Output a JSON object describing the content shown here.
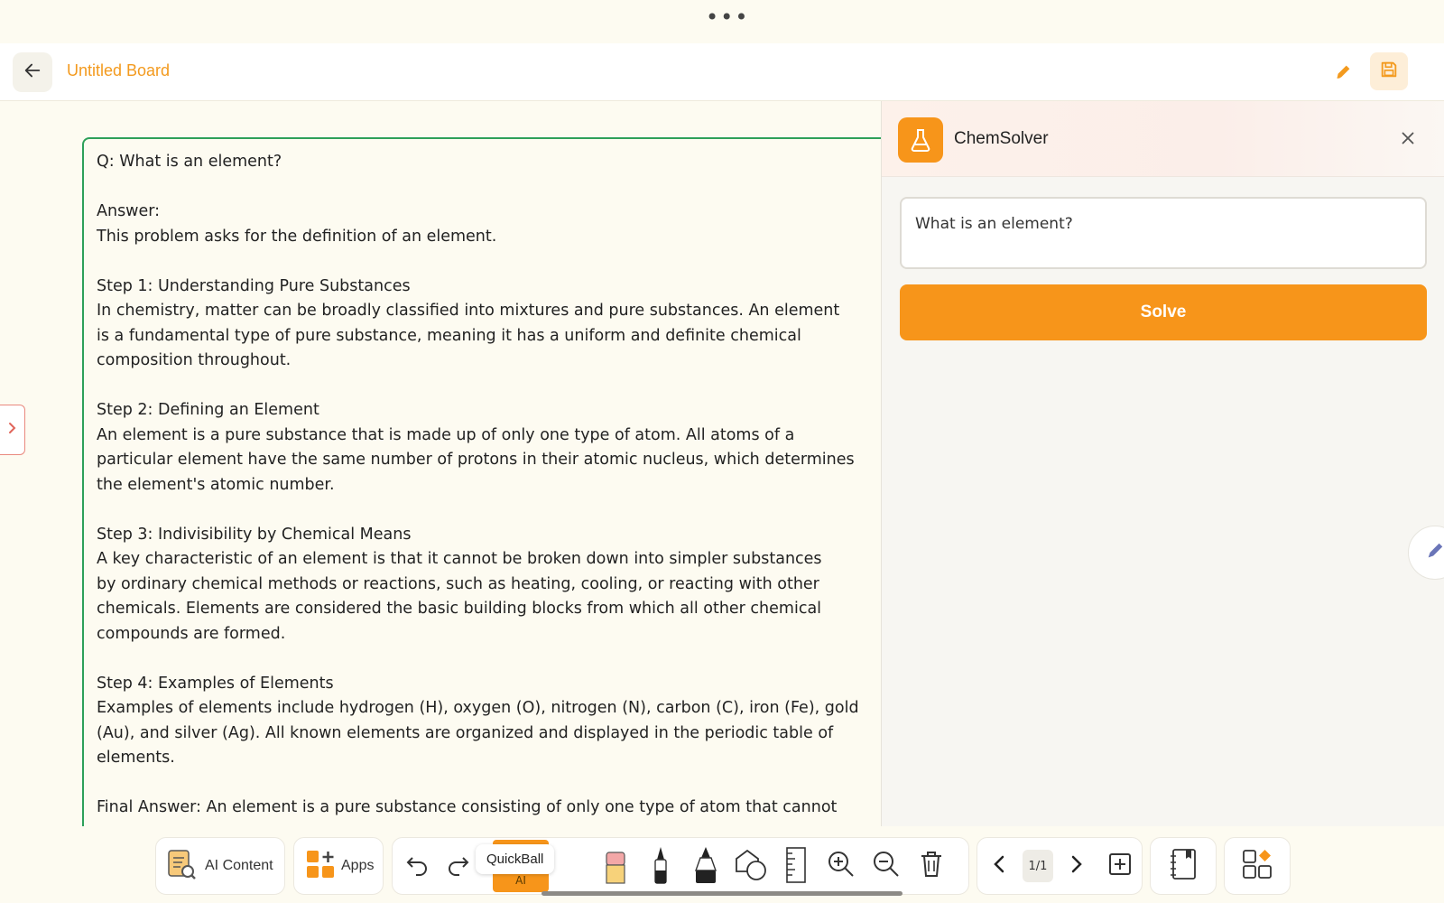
{
  "window": {
    "title": "Untitled Board",
    "more_icon": "•••"
  },
  "canvas": {
    "content": "Q: What is an element?\n\nAnswer:\nThis problem asks for the definition of an element.\n\nStep 1: Understanding Pure Substances\nIn chemistry, matter can be broadly classified into mixtures and pure substances. An element\nis a fundamental type of pure substance, meaning it has a uniform and definite chemical\ncomposition throughout.\n\nStep 2: Defining an Element\nAn element is a pure substance that is made up of only one type of atom. All atoms of a\nparticular element have the same number of protons in their atomic nucleus, which determines\nthe element's atomic number.\n\nStep 3: Indivisibility by Chemical Means\nA key characteristic of an element is that it cannot be broken down into simpler substances\nby ordinary chemical methods or reactions, such as heating, cooling, or reacting with other\nchemicals. Elements are considered the basic building blocks from which all other chemical\ncompounds are formed.\n\nStep 4: Examples of Elements\nExamples of elements include hydrogen (H), oxygen (O), nitrogen (N), carbon (C), iron (Fe), gold\n(Au), and silver (Ag). All known elements are organized and displayed in the periodic table of\nelements.\n\nFinal Answer: An element is a pure substance consisting of only one type of atom that cannot"
  },
  "panel": {
    "title": "ChemSolver",
    "question_value": "What is an element?",
    "solve_label": "Solve"
  },
  "toolbar": {
    "ai_content_label": "AI Content",
    "apps_label": "Apps",
    "quickball_label": "QuickBall",
    "ai_tag": "AI",
    "page_indicator": "1/1"
  },
  "colors": {
    "accent": "#f7951a",
    "title": "#f39a1e",
    "canvas_border": "#2ea05a",
    "background": "#fdfbf1"
  }
}
